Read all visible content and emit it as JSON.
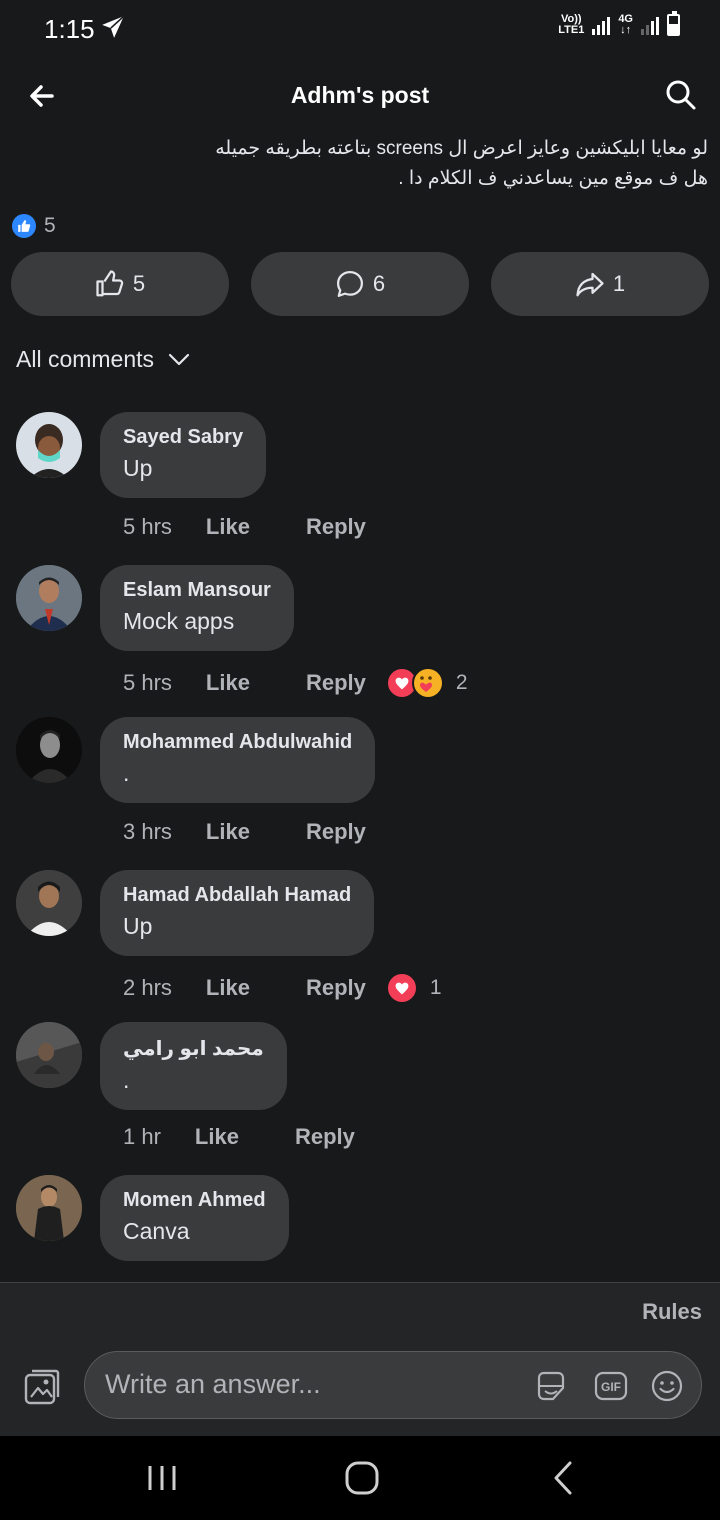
{
  "status_bar": {
    "time": "1:15",
    "network_top": "Vo))",
    "network_bottom": "LTE1",
    "data_top": "4G",
    "data_bottom": "↓↑",
    "icons": [
      "telegram-send-icon",
      "signal-icon",
      "battery-icon"
    ]
  },
  "header": {
    "title": "Adhm's post",
    "back_icon": "arrow-left-icon",
    "search_icon": "search-icon"
  },
  "post": {
    "text_line1": "لو معايا ابليكشين وعايز اعرض ال screens بتاعته بطريقه جميله",
    "text_line2": "هل ف موقع مين يساعدني ف الكلام دا .",
    "reaction_count": "5"
  },
  "actions": {
    "like_count": "5",
    "comment_count": "6",
    "share_count": "1"
  },
  "comments_filter": "All comments",
  "comments": [
    {
      "author": "Sayed Sabry",
      "text": "Up",
      "time": "5 hrs",
      "like": "Like",
      "reply": "Reply"
    },
    {
      "author": "Eslam Mansour",
      "text": "Mock apps",
      "time": "5 hrs",
      "like": "Like",
      "reply": "Reply",
      "reaction_count": "2"
    },
    {
      "author": "Mohammed Abdulwahid",
      "text": ".",
      "time": "3 hrs",
      "like": "Like",
      "reply": "Reply"
    },
    {
      "author": "Hamad Abdallah Hamad",
      "text": "Up",
      "time": "2 hrs",
      "like": "Like",
      "reply": "Reply",
      "reaction_count": "1"
    },
    {
      "author": "محمد ابو رامي",
      "text": ".",
      "time": "1 hr",
      "like": "Like",
      "reply": "Reply"
    },
    {
      "author": "Momen Ahmed",
      "text": "Canva"
    }
  ],
  "composer": {
    "rules": "Rules",
    "placeholder": "Write an answer...",
    "icons": [
      "photo-icon",
      "sticker-icon",
      "gif-icon",
      "emoji-icon"
    ]
  },
  "colors": {
    "background": "#18191a",
    "bubble": "#3a3b3c",
    "like_blue": "#2d88ff",
    "heart_red": "#f33e58"
  }
}
